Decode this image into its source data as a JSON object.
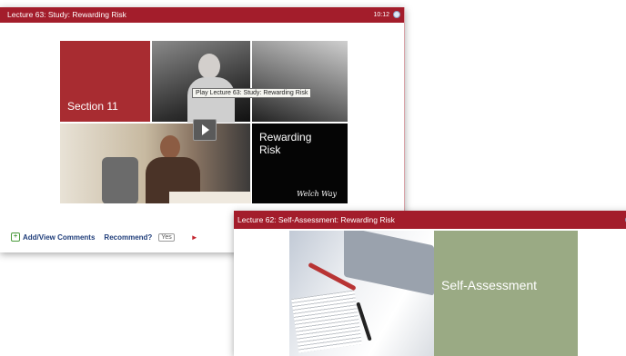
{
  "lecture1": {
    "title": "Lecture 63: Study: Rewarding Risk",
    "duration": "10:12",
    "thumbnail": {
      "section_label": "Section 11",
      "topic_line1": "Rewarding",
      "topic_line2": "Risk",
      "signature": "Welch Way",
      "tooltip": "Play Lecture 63: Study: Rewarding Risk"
    },
    "actions": {
      "comments_label": "Add/View Comments",
      "recommend_label": "Recommend?",
      "yes_label": "Yes"
    }
  },
  "lecture2": {
    "title": "Lecture 62: Self-Assessment: Rewarding Risk",
    "thumbnail": {
      "label": "Self-Assessment"
    }
  },
  "colors": {
    "title_bar": "#a31d2b",
    "section_tile": "#a82c31",
    "self_assessment_tile": "#9aaa84",
    "link": "#1f3d7a"
  },
  "icons": [
    "comment-icon",
    "play-icon",
    "status-dot-icon",
    "next-arrow-icon"
  ]
}
